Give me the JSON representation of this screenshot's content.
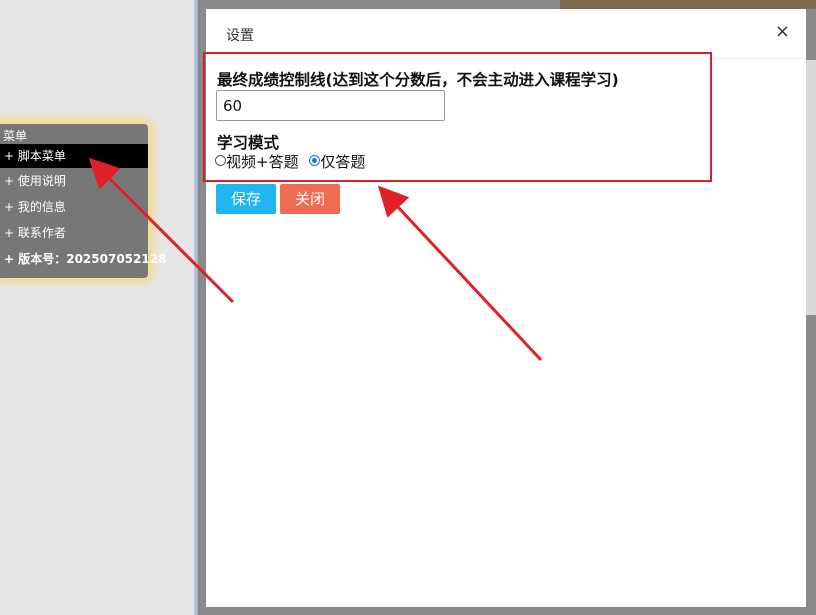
{
  "menu": {
    "title": "菜单",
    "items": [
      {
        "label": "+ 脚本菜单"
      },
      {
        "label": "+ 使用说明"
      },
      {
        "label": "+ 我的信息"
      },
      {
        "label": "+ 联系作者"
      },
      {
        "label": "+ 版本号：202507052128"
      }
    ]
  },
  "dialog": {
    "title": "设置",
    "close_icon": "×",
    "score_label": "最终成绩控制线(达到这个分数后，不会主动进入课程学习)",
    "score_value": "60",
    "mode_label": "学习模式",
    "mode_options": [
      {
        "label": "视频+答题",
        "checked": false
      },
      {
        "label": "仅答题",
        "checked": true
      }
    ],
    "save_label": "保存",
    "close_label": "关闭"
  },
  "colors": {
    "save_button": "#1fb5ee",
    "close_button": "#ef6b54",
    "highlight": "#d81e2a",
    "menu_glow": "#f7d87a"
  }
}
